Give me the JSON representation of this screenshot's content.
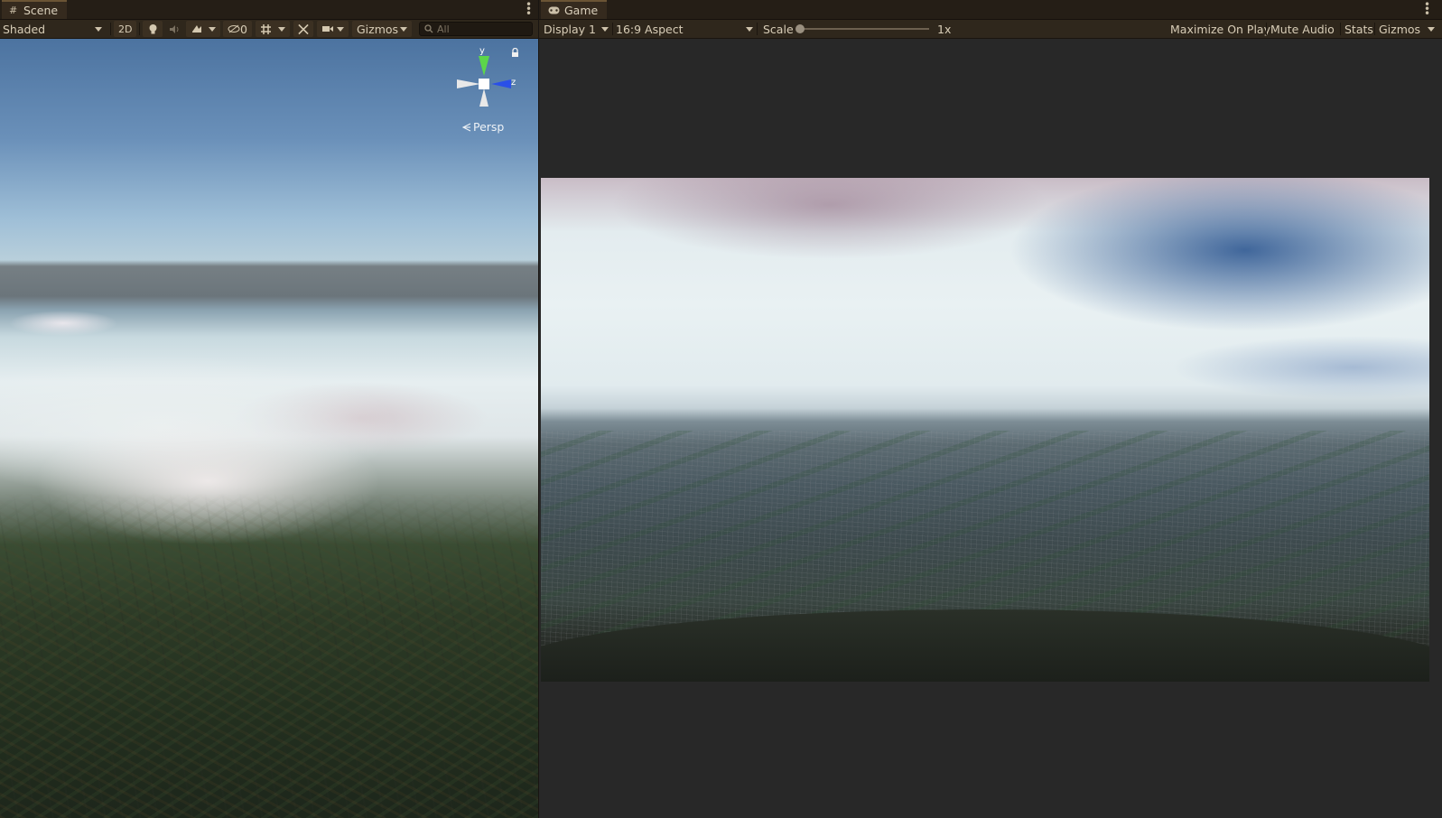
{
  "scene": {
    "tab_title": "Scene",
    "toolbar": {
      "shading_mode": "Shaded",
      "btn_2d": "2D",
      "hidden_count": "0",
      "gizmos": "Gizmos",
      "search_placeholder": "All"
    },
    "gizmo": {
      "y_label": "y",
      "z_label": "z",
      "projection": "Persp"
    }
  },
  "game": {
    "tab_title": "Game",
    "toolbar": {
      "display": "Display 1",
      "aspect": "16:9 Aspect",
      "scale_label": "Scale",
      "scale_value": "1x",
      "scale_fraction": 0,
      "maximize_on_play": "Maximize On Play",
      "mute_audio": "Mute Audio",
      "stats": "Stats",
      "gizmos": "Gizmos"
    }
  },
  "colors": {
    "editor_bg": "#282828",
    "tab_bar": "#251e16",
    "toolbar_bg": "#2f271c",
    "axis_y": "#5cd64a",
    "axis_z": "#2a50e8"
  },
  "icons": {
    "scene_tab": "grid-hash-icon",
    "game_tab": "gamepad-icon",
    "lighting": "lightbulb-icon",
    "audio": "speaker-icon",
    "effects": "effects-icon",
    "visibility": "eye-slash-icon",
    "grid": "grid-icon",
    "tools": "tools-icon",
    "camera": "camera-icon",
    "search": "search-icon",
    "lock": "lock-icon",
    "menu": "kebab-menu-icon"
  }
}
